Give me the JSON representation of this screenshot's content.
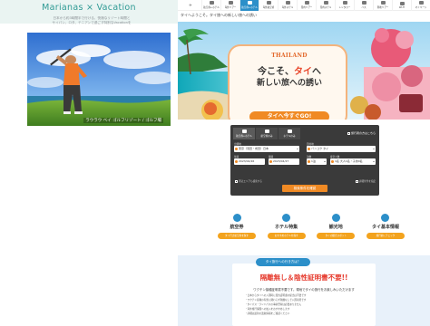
{
  "left_card": {
    "title": "Marianas × Vacation",
    "lines": [
      "日本から約3時間半で行ける、快適なリゾート時間と",
      "サイパン、ロタ、テニアンで過ごす特別なVacationを"
    ],
    "photo_caption": "ラウラウ ベイ ゴルフリゾート / ゴルフ場"
  },
  "site": {
    "nav": [
      {
        "label": "航空券+ホテル",
        "active": false
      },
      {
        "label": "海外ツアー",
        "active": false
      },
      {
        "label": "航空券+ホテル",
        "active": true
      },
      {
        "label": "海外航空券",
        "active": false
      },
      {
        "label": "海外ホテル",
        "active": false
      },
      {
        "label": "国内ツアー",
        "active": false
      },
      {
        "label": "国内ホテル",
        "active": false
      },
      {
        "label": "レンタカー",
        "active": false
      },
      {
        "label": "バス",
        "active": false
      },
      {
        "label": "現地ツアー",
        "active": false
      },
      {
        "label": "Wi-Fi",
        "active": false
      },
      {
        "label": "マイページ",
        "active": false
      }
    ],
    "welcome": "タイへようこそ。タイ旅への新しい旅への誘い",
    "hero": {
      "logo": "THAILAND",
      "line1_a": "今こそ、",
      "line1_b": "タイ",
      "line1_c": "へ",
      "line2": "新しい旅への誘い",
      "cta": "タイへ今すぐGO!"
    },
    "search": {
      "tabs": [
        "航空券+ホテル",
        "航空券のみ",
        "ホテルのみ"
      ],
      "right_link": "旅行者の方はこちら",
      "depart_label": "出発地",
      "depart_value": "東京（羽田・成田）日本",
      "arrive_label": "目的地",
      "arrive_value": "バンコク タイ",
      "go_label": "往路",
      "go_value": "2023/04/26",
      "back_label": "復路",
      "back_value": "2023/04/27",
      "nights_label": "泊数",
      "nights_value": "1泊",
      "guests_label": "客室人数",
      "guests_value": "1名 大人1名・子供0名",
      "option": "周辺エリアも検索する",
      "button": "検索条件を確認",
      "detail": "詳細条件を指定"
    },
    "categories": [
      {
        "title": "航空券",
        "button": "タイ行き航空券を探す"
      },
      {
        "title": "ホテル特集",
        "button": "おすすめホテルを探す"
      },
      {
        "title": "観光地",
        "button": "タイの観光スポット"
      },
      {
        "title": "タイ基本情報",
        "button": "旅行前にチェック"
      }
    ],
    "notice": {
      "pill": "タイ旅行への行き方は？",
      "title": "隔離無し＆陰性証明書不要!!",
      "sub": "ワクチン接種証明書不要です。現地でタイの旅行をお楽しみいただけます",
      "lines": [
        "・日本からタイへの入国時に陰性証明書の提出は不要です",
        "・ワクチン接種の有無に関わらず隔離なしで入国可能です",
        "・タイパス・ランドパスの事前登録は必要ありません",
        "・海外旅行保険への加入をおすすめします",
        "・詳細は最新の渡航情報をご確認ください"
      ]
    }
  },
  "colors": {
    "accent_teal": "#2f9a94",
    "nav_active": "#2c8fc9",
    "cta_orange": "#f08a24",
    "notice_red": "#e63c2f"
  }
}
